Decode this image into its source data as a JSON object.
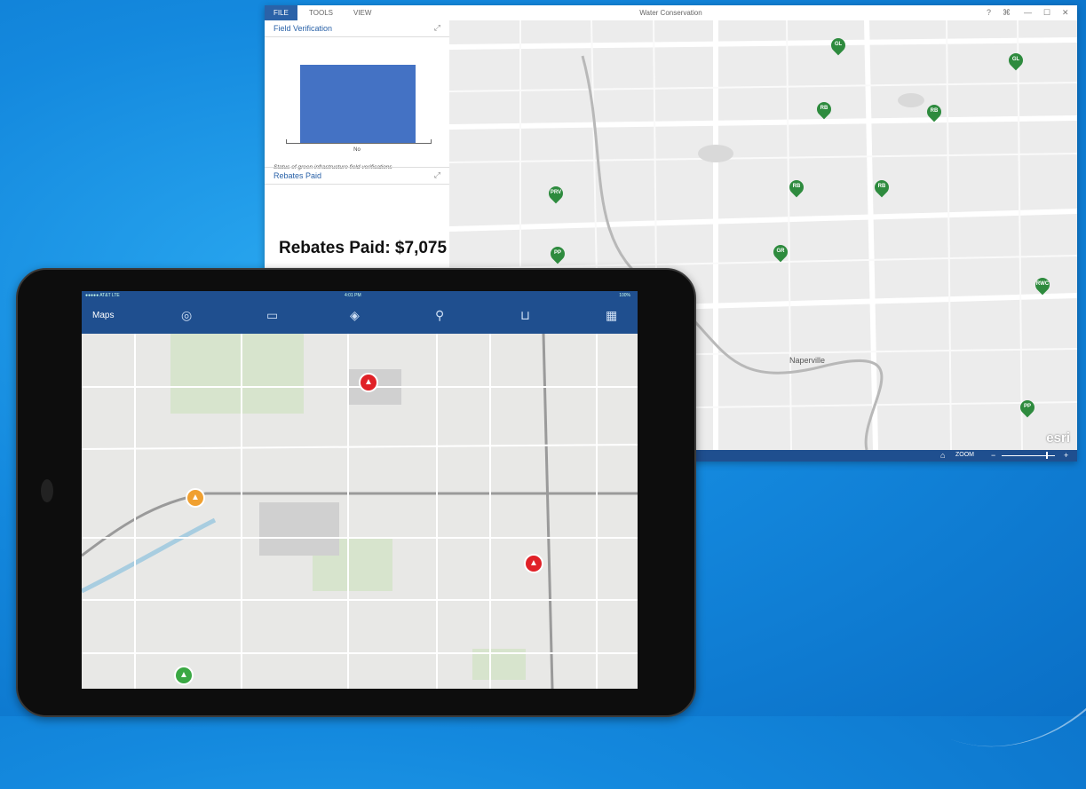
{
  "window": {
    "tabs": [
      "FILE",
      "TOOLS",
      "VIEW"
    ],
    "title": "Water Conservation",
    "controls": [
      "?",
      "⌘",
      "—",
      "☐",
      "✕"
    ]
  },
  "panels": {
    "field_verification": {
      "title": "Field Verification",
      "bar_label": "No",
      "caption": "Status of green infrastructure field verifications"
    },
    "rebates": {
      "title": "Rebates Paid",
      "value_text": "Rebates Paid: $7,075"
    }
  },
  "chart_data": {
    "type": "bar",
    "categories": [
      "No"
    ],
    "values": [
      1
    ],
    "title": "Field Verification"
  },
  "map": {
    "place_label": "Naperville",
    "pins": [
      "GL",
      "GL",
      "RB",
      "RB",
      "RB",
      "RB",
      "PRV",
      "PP",
      "GR",
      "RWC",
      "PP"
    ],
    "pin_color": "#2e8b3e",
    "logo": "esri"
  },
  "statusbar": {
    "zoom_label": "ZOOM"
  },
  "tablet": {
    "status_left": "●●●●● AT&T LTE",
    "status_time": "4:01 PM",
    "status_right": "100%",
    "app_title": "Maps",
    "toolbar_icons": [
      "locate-icon",
      "book-icon",
      "layers-icon",
      "search-icon",
      "measure-icon",
      "qr-icon"
    ],
    "markers": [
      {
        "color": "#e02127"
      },
      {
        "color": "#f0a030"
      },
      {
        "color": "#e02127"
      },
      {
        "color": "#3aa843"
      }
    ]
  },
  "colors": {
    "accent": "#2a62a8",
    "status_bar": "#1f4f8f",
    "chart_bar": "#4472c4"
  }
}
